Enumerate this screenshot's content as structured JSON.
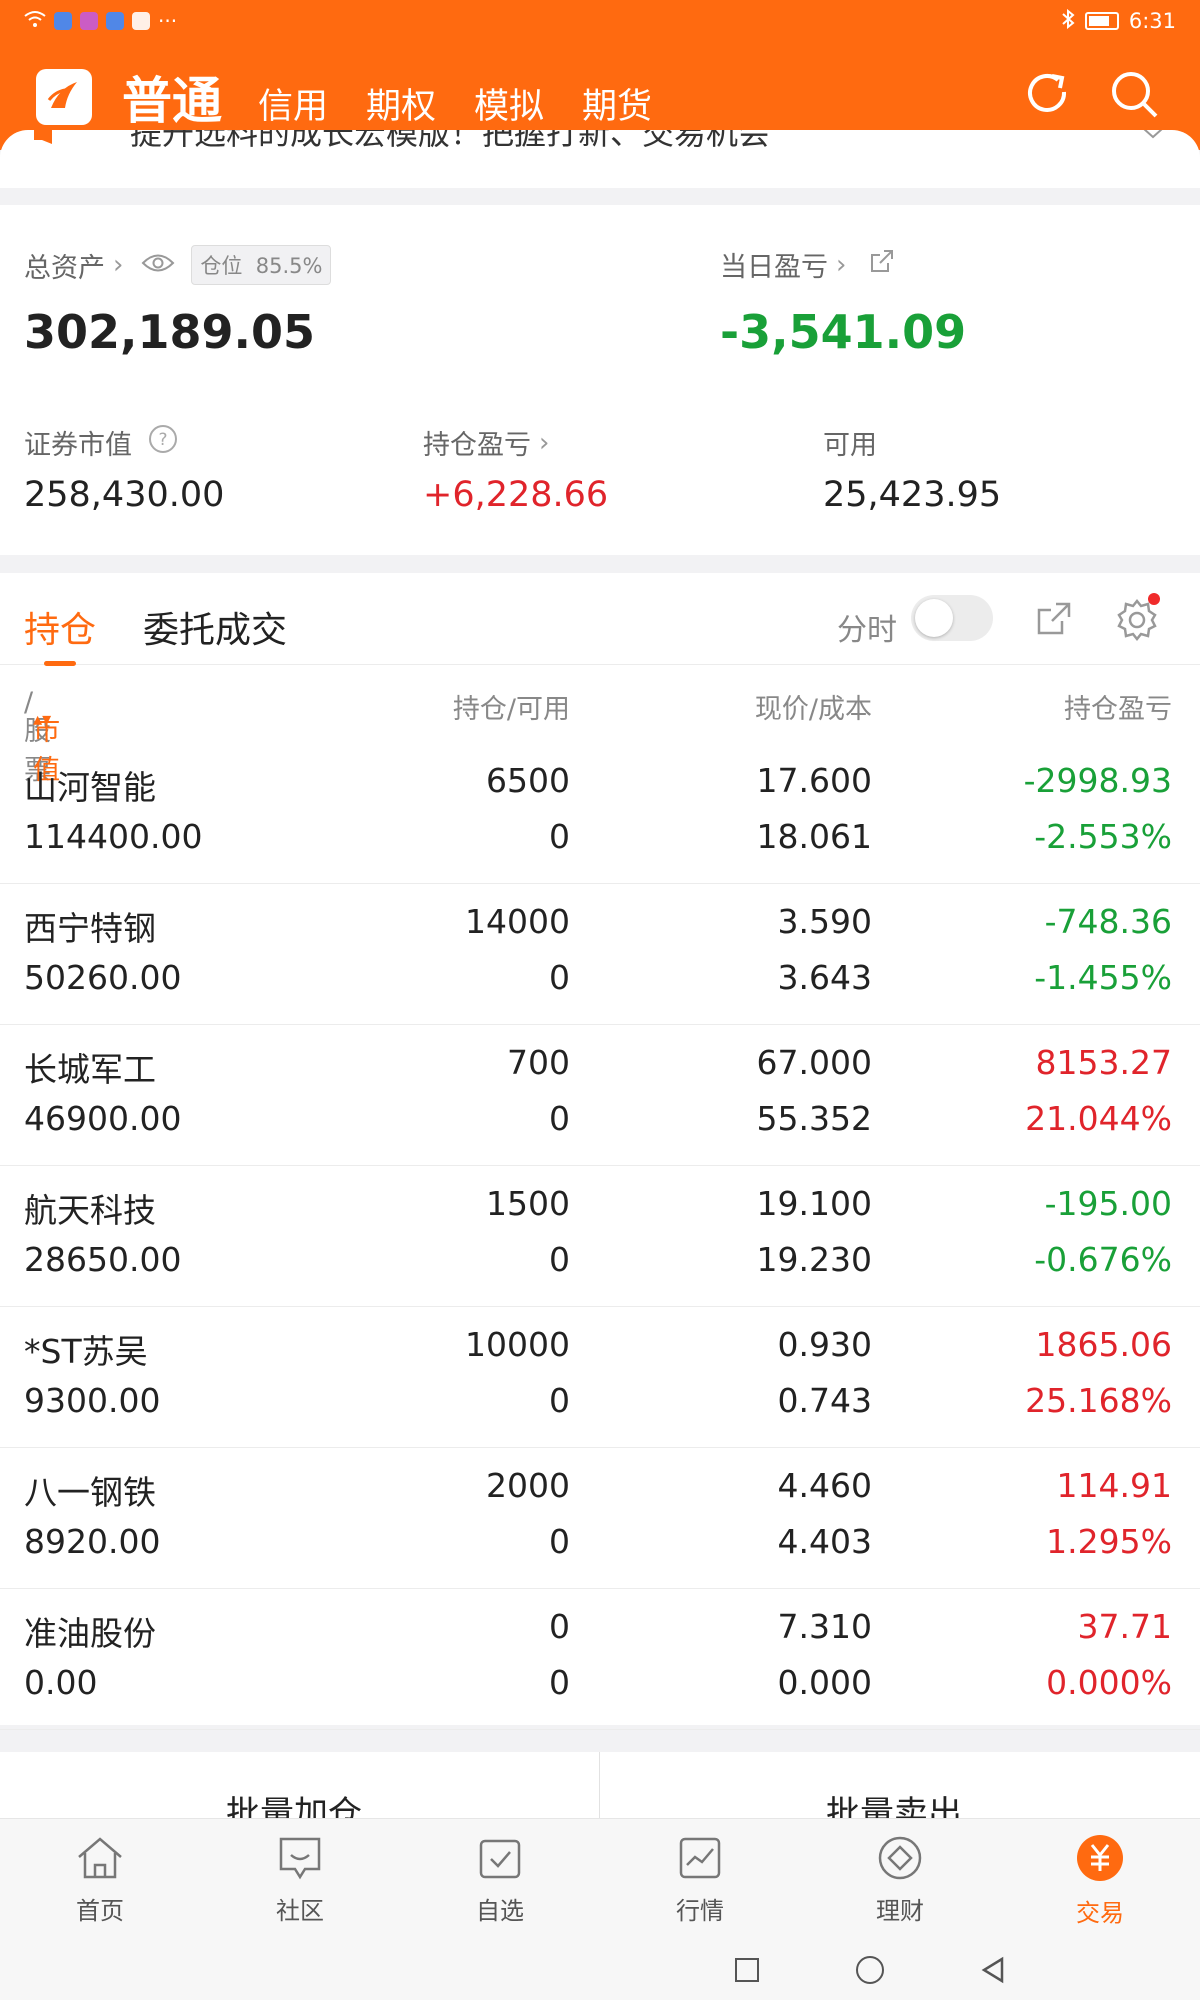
{
  "status": {
    "time": "6:31",
    "more": "···"
  },
  "header": {
    "tabs": [
      "普通",
      "信用",
      "期权",
      "模拟",
      "期货"
    ]
  },
  "banner": {
    "text": "提升选料的成长宏模版！把握打新、交易机会"
  },
  "summary": {
    "total_assets_label": "总资产",
    "position_badge_label": "仓位",
    "position_badge_value": "85.5%",
    "total_assets": "302,189.05",
    "daily_pl_label": "当日盈亏",
    "daily_pl": "-3,541.09",
    "market_value_label": "证券市值",
    "market_value": "258,430.00",
    "holding_pl_label": "持仓盈亏",
    "holding_pl": "+6,228.66",
    "available_label": "可用",
    "available": "25,423.95"
  },
  "holdings": {
    "tab_active": "持仓",
    "tab_other": "委托成交",
    "toggle_label": "分时",
    "columns": {
      "stock": "股票",
      "market_value": "市值",
      "position": "持仓/可用",
      "price": "现价/成本",
      "pl": "持仓盈亏"
    },
    "rows": [
      {
        "name": "山河智能",
        "value": "114400.00",
        "qty": "6500",
        "avail": "0",
        "price": "17.600",
        "cost": "18.061",
        "pl": "-2998.93",
        "pct": "-2.553%",
        "dir": "down"
      },
      {
        "name": "西宁特钢",
        "value": "50260.00",
        "qty": "14000",
        "avail": "0",
        "price": "3.590",
        "cost": "3.643",
        "pl": "-748.36",
        "pct": "-1.455%",
        "dir": "down"
      },
      {
        "name": "长城军工",
        "value": "46900.00",
        "qty": "700",
        "avail": "0",
        "price": "67.000",
        "cost": "55.352",
        "pl": "8153.27",
        "pct": "21.044%",
        "dir": "up"
      },
      {
        "name": "航天科技",
        "value": "28650.00",
        "qty": "1500",
        "avail": "0",
        "price": "19.100",
        "cost": "19.230",
        "pl": "-195.00",
        "pct": "-0.676%",
        "dir": "down"
      },
      {
        "name": "*ST苏吴",
        "value": "9300.00",
        "qty": "10000",
        "avail": "0",
        "price": "0.930",
        "cost": "0.743",
        "pl": "1865.06",
        "pct": "25.168%",
        "dir": "up"
      },
      {
        "name": "八一钢铁",
        "value": "8920.00",
        "qty": "2000",
        "avail": "0",
        "price": "4.460",
        "cost": "4.403",
        "pl": "114.91",
        "pct": "1.295%",
        "dir": "up"
      },
      {
        "name": "准油股份",
        "value": "0.00",
        "qty": "0",
        "avail": "0",
        "price": "7.310",
        "cost": "0.000",
        "pl": "37.71",
        "pct": "0.000%",
        "dir": "up"
      }
    ]
  },
  "batch": {
    "add": "批量加仓",
    "sell": "批量卖出"
  },
  "bottom_nav": [
    {
      "label": "首页",
      "icon": "home-icon"
    },
    {
      "label": "社区",
      "icon": "community-icon"
    },
    {
      "label": "自选",
      "icon": "watchlist-icon"
    },
    {
      "label": "行情",
      "icon": "market-icon"
    },
    {
      "label": "理财",
      "icon": "wealth-icon"
    },
    {
      "label": "交易",
      "icon": "trade-icon"
    }
  ],
  "colors": {
    "brand": "#ff6a10",
    "up": "#e0242b",
    "down": "#19a038"
  }
}
